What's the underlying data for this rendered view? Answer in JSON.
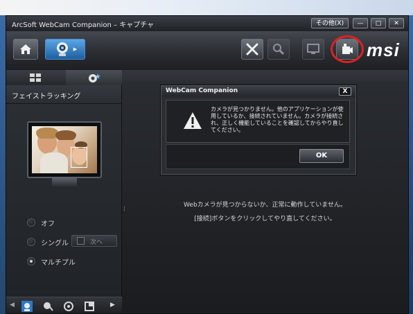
{
  "window": {
    "title": "ArcSoft WebCam Companion – キャプチャ",
    "other_menu_label": "その他(X)",
    "minimize_label": "—",
    "maximize_label": "□",
    "close_label": "✕"
  },
  "toolbar": {
    "brand_logo": "msi",
    "icons": [
      "home-icon",
      "webcam-icon",
      "tools-icon",
      "search-icon",
      "monitor-icon",
      "connect-camera-icon"
    ]
  },
  "left_panel": {
    "heading": "フェイストラッキング",
    "options": [
      {
        "label": "オフ",
        "selected": false
      },
      {
        "label": "シングル",
        "selected": false
      },
      {
        "label": "マルチプル",
        "selected": true
      }
    ],
    "next_button_label": "次へ"
  },
  "dialog": {
    "title": "WebCam Companion",
    "close_label": "X",
    "message": "カメラが見つかりません。他のアプリケーションが使用しているか、接続されていません。カメラが接続され、正しく機能していることを確認してからやり直してください。",
    "ok_label": "OK"
  },
  "main_status": {
    "line1": "Webカメラが見つからないか、正常に動作していません。",
    "line2": "[接続]ボタンをクリックしてやり直してください。"
  },
  "colors": {
    "highlight_circle": "#e02020",
    "accent_blue": "#3aa0e8",
    "text": "#e0e0e0"
  }
}
